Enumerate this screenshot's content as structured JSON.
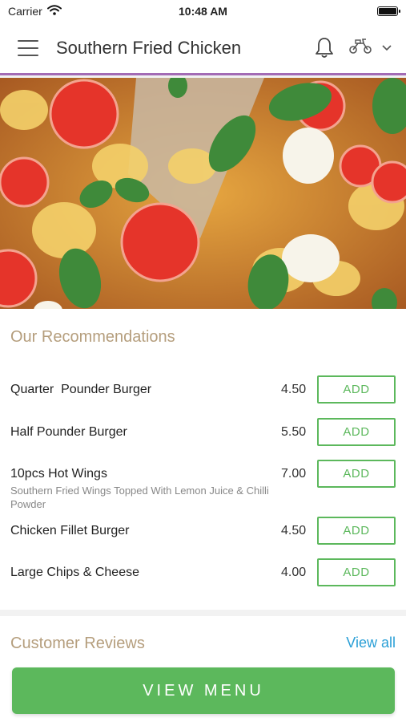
{
  "status_bar": {
    "carrier": "Carrier",
    "time": "10:48 AM"
  },
  "header": {
    "title": "Southern Fried Chicken",
    "icons": [
      "menu-icon",
      "bell-icon",
      "scooter-icon",
      "chevron-down-icon"
    ]
  },
  "hero": {
    "image": "pizza-photo"
  },
  "recommendations": {
    "title": "Our Recommendations",
    "add_label": "ADD",
    "items": [
      {
        "name": "Quarter  Pounder Burger",
        "description": "",
        "price": "4.50"
      },
      {
        "name": "Half Pounder Burger",
        "description": "",
        "price": "5.50"
      },
      {
        "name": "10pcs Hot Wings",
        "description": "Southern Fried Wings Topped With Lemon Juice & Chilli Powder",
        "price": "7.00"
      },
      {
        "name": "Chicken Fillet Burger",
        "description": "",
        "price": "4.50"
      },
      {
        "name": "Large Chips & Cheese",
        "description": "",
        "price": "4.00"
      }
    ]
  },
  "reviews": {
    "title": "Customer Reviews",
    "view_all_label": "View all"
  },
  "footer": {
    "view_menu_label": "VIEW MENU"
  },
  "colors": {
    "accent_green": "#5cb85c",
    "section_title": "#b59e7d",
    "link_blue": "#2a9fd6",
    "header_border": "#a36bb5"
  }
}
